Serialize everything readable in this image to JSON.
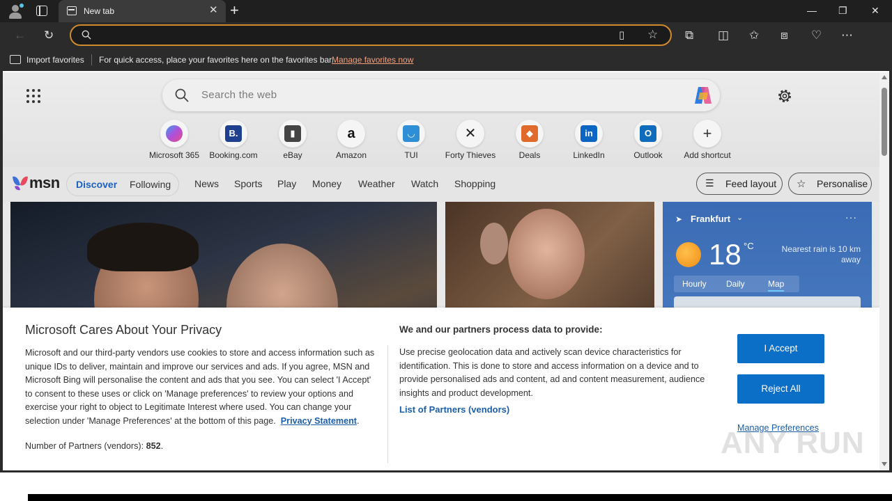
{
  "browser": {
    "tab_title": "New tab",
    "tab_close": "✕",
    "new_tab": "+",
    "window": {
      "minimize": "—",
      "restore": "❐",
      "close": "✕"
    },
    "address_value": ""
  },
  "favorites_bar": {
    "import_label": "Import favorites",
    "message": "For quick access, place your favorites here on the favorites bar.",
    "manage_link": "Manage favorites now"
  },
  "newtab": {
    "search_placeholder": "Search the web",
    "shortcuts": [
      {
        "label": "Microsoft 365",
        "glyph": "",
        "color": "#8b5cf6"
      },
      {
        "label": "Booking.com",
        "glyph": "B.",
        "color": "#1f3f8f"
      },
      {
        "label": "eBay",
        "glyph": "▮",
        "color": "#444444"
      },
      {
        "label": "Amazon",
        "glyph": "a",
        "color": "#111111"
      },
      {
        "label": "TUI",
        "glyph": "◡",
        "color": "#2f8fd6"
      },
      {
        "label": "Forty Thieves",
        "glyph": "✕",
        "color": "#222222"
      },
      {
        "label": "Deals",
        "glyph": "◆",
        "color": "#e06a2c"
      },
      {
        "label": "LinkedIn",
        "glyph": "in",
        "color": "#0a66c2"
      },
      {
        "label": "Outlook",
        "glyph": "O",
        "color": "#0f6cbd"
      },
      {
        "label": "Add shortcut",
        "glyph": "+",
        "color": "#333333"
      }
    ]
  },
  "msn": {
    "logo": "msn",
    "segment_active": "Discover",
    "segment_other": "Following",
    "nav": [
      "News",
      "Sports",
      "Play",
      "Money",
      "Weather",
      "Watch",
      "Shopping"
    ],
    "feed_layout": "Feed layout",
    "personalise": "Personalise"
  },
  "weather": {
    "city": "Frankfurt",
    "temp": "18",
    "unit": "°C",
    "rain": "Nearest rain is 10 km away",
    "tabs": [
      "Hourly",
      "Daily",
      "Map"
    ],
    "active_tab": "Map"
  },
  "consent": {
    "title": "Microsoft Cares About Your Privacy",
    "body": "Microsoft and our third-party vendors use cookies to store and access information such as unique IDs to deliver, maintain and improve our services and ads. If you agree, MSN and Microsoft Bing will personalise the content and ads that you see. You can select 'I Accept' to consent to these uses or click on 'Manage preferences' to review your options and exercise your right to object to Legitimate Interest where used.  You can change your selection under 'Manage Preferences' at the bottom of this page.",
    "privacy_link": "Privacy Statement",
    "partners_label": "Number of Partners (vendors):",
    "partners_count": "852",
    "right_title": "We and our partners process data to provide:",
    "right_body": "Use precise geolocation data and actively scan device characteristics for identification. This is done to store and access information on a device and to provide personalised ads and content, ad and content measurement, audience insights and product development.",
    "vendors_link": "List of Partners (vendors)",
    "accept": "I Accept",
    "reject": "Reject All",
    "manage": "Manage Preferences"
  },
  "watermark": "ANY RUN",
  "colors": {
    "accent": "#0b6ec7",
    "link": "#1b5fa8",
    "address_border": "#d08a2e"
  }
}
